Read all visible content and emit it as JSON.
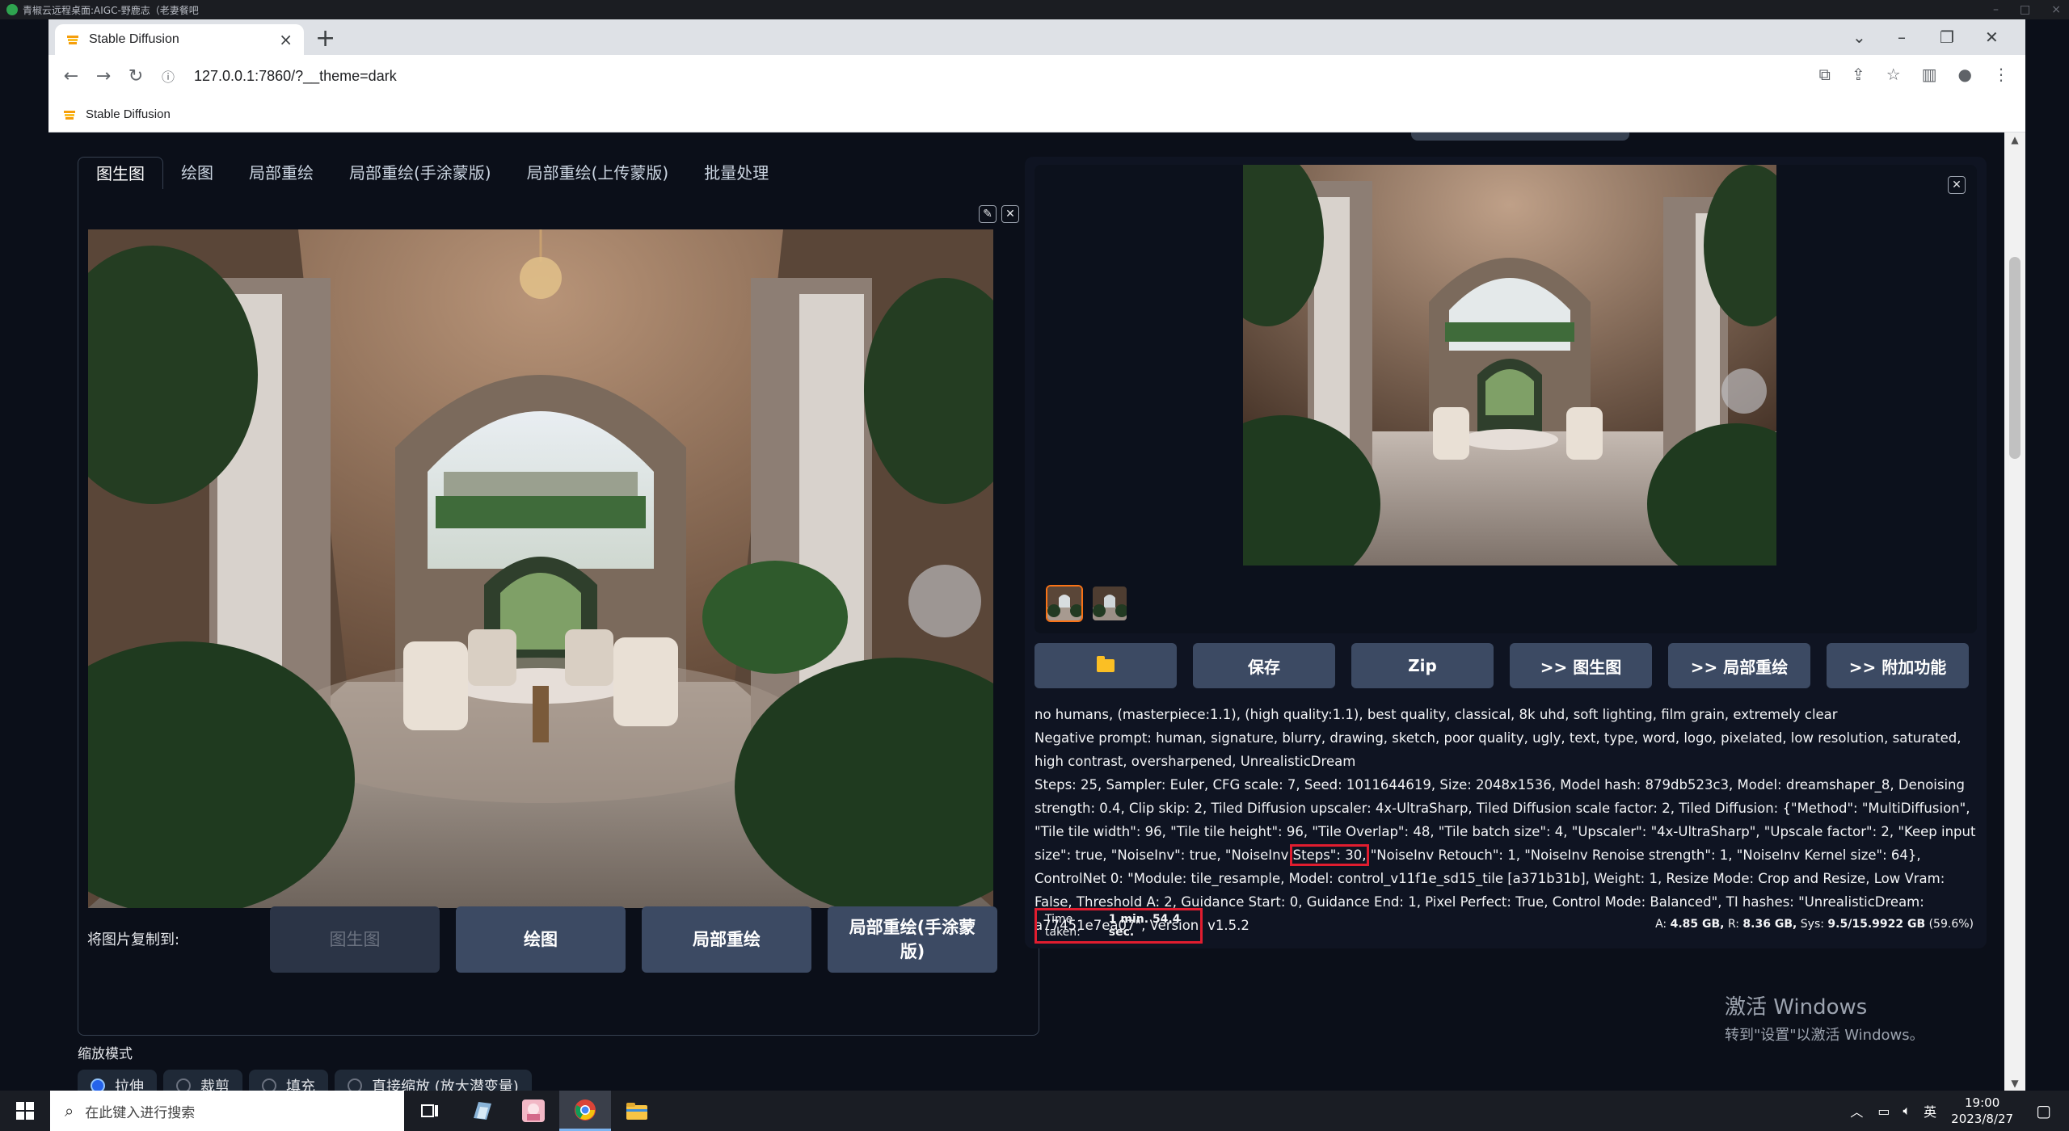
{
  "remote_desktop": {
    "title": "青椒云远程桌面:AIGC-野鹿志（老妻餐吧"
  },
  "browser": {
    "tab_title": "Stable Diffusion",
    "url": "127.0.0.1:7860/?__theme=dark",
    "bookmark": "Stable Diffusion",
    "new_tab": "+",
    "tab_close": "×"
  },
  "left": {
    "tabs": [
      "图生图",
      "绘图",
      "局部重绘",
      "局部重绘(手涂蒙版)",
      "局部重绘(上传蒙版)",
      "批量处理"
    ],
    "copy_label": "将图片复制到:",
    "copy_buttons": [
      "图生图",
      "绘图",
      "局部重绘",
      "局部重绘(手涂蒙版)"
    ],
    "scale_label": "缩放模式",
    "scale_modes": [
      "拉伸",
      "裁剪",
      "填充",
      "直接缩放 (放大潜变量)"
    ]
  },
  "right": {
    "actions": [
      "保存",
      "Zip",
      ">> 图生图",
      ">> 局部重绘",
      ">> 附加功能"
    ],
    "prompt": "no humans, (masterpiece:1.1), (high quality:1.1), best quality, classical, 8k uhd, soft lighting, film grain, extremely clear",
    "negative": "Negative prompt: human, signature, blurry, drawing, sketch, poor quality, ugly, text, type, word, logo, pixelated, low resolution, saturated, high contrast, oversharpened, UnrealisticDream",
    "params_a": "Steps: 25, Sampler: Euler, CFG scale: 7, Seed: 1011644619, Size: 2048x1536, Model hash: 879db523c3, Model: dreamshaper_8, Denoising strength: 0.4, Clip skip: 2, Tiled Diffusion upscaler: 4x-UltraSharp, Tiled Diffusion scale factor: 2, Tiled Diffusion: {\"Method\": \"MultiDiffusion\", \"Tile tile width\": 96, \"Tile tile height\": 96, \"Tile Overlap\": 48, \"Tile batch size\": 4, \"Upscaler\": \"4x-UltraSharp\", \"Upscale factor\": 2, \"Keep input size\": true, \"NoiseInv\": true, \"NoiseInv",
    "params_mark": "Steps\": 30,",
    "params_b": " \"NoiseInv Retouch\": 1, \"NoiseInv Renoise strength\": 1, \"NoiseInv Kernel size\": 64}, ControlNet 0: \"Module: tile_resample, Model: control_v11f1e_sd15_tile [a371b31b], Weight: 1, Resize Mode: Crop and Resize, Low Vram: False, Threshold A: 2, Guidance Start: 0, Guidance End: 1, Pixel Perfect: True, Control Mode: Balanced\", TI hashes: \"UnrealisticDream: a77451e7ea07\", Version: v1.5.2",
    "time_label": "Time taken:",
    "time_value": "1 min. 54.4 sec.",
    "mem_a_label": "A:",
    "mem_a": "4.85 GB,",
    "mem_r_label": "R:",
    "mem_r": "8.36 GB,",
    "mem_sys_label": "Sys:",
    "mem_sys": "9.5/15.9922 GB",
    "mem_pct": "(59.6%)"
  },
  "watermark": {
    "line1": "激活 Windows",
    "line2": "转到\"设置\"以激活 Windows。"
  },
  "taskbar": {
    "search_placeholder": "在此键入进行搜索",
    "ime": "英",
    "time": "19:00",
    "date": "2023/8/27"
  },
  "colors": {
    "accent_red": "#e11d2f",
    "button_bg": "#3c4a63",
    "page_bg": "#0b0f19"
  }
}
